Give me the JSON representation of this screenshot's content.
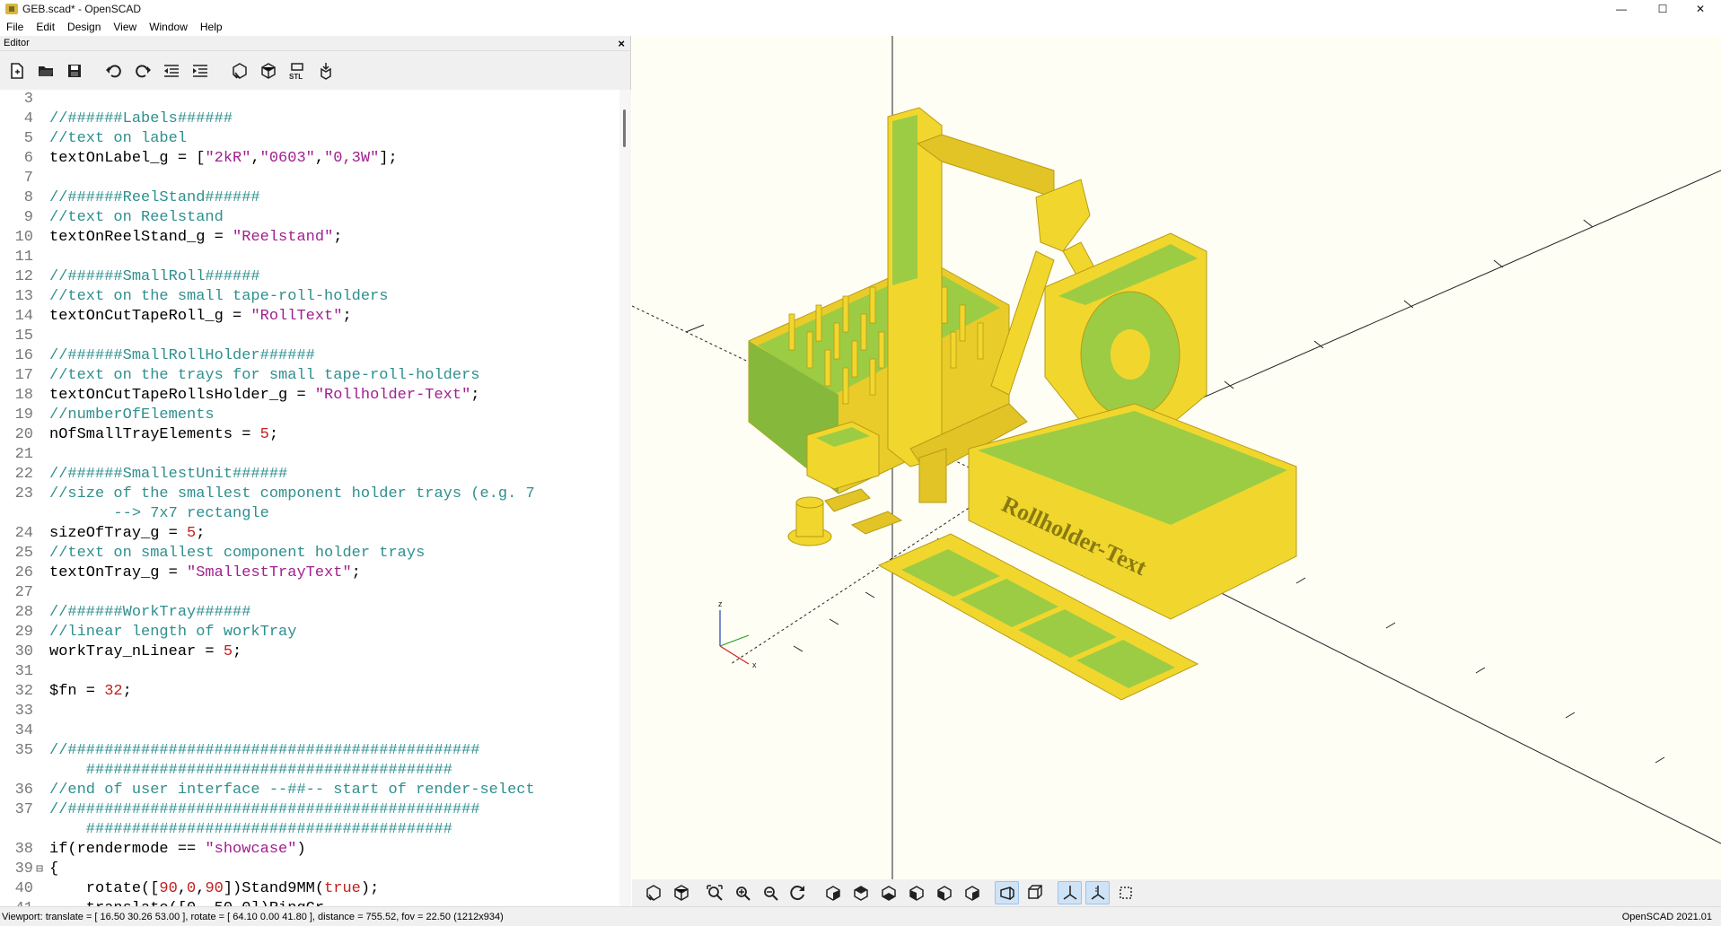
{
  "window": {
    "title": "GEB.scad* - OpenSCAD",
    "minimize_glyph": "—",
    "maximize_glyph": "☐",
    "close_glyph": "✕"
  },
  "menu": [
    "File",
    "Edit",
    "Design",
    "View",
    "Window",
    "Help"
  ],
  "editor": {
    "panel_title": "Editor",
    "close_glyph": "×",
    "toolbar_icons": [
      "new-file-icon",
      "open-file-icon",
      "save-icon",
      "undo-icon",
      "redo-icon",
      "unindent-icon",
      "indent-icon",
      "preview-icon",
      "render-icon",
      "export-stl-icon",
      "send-to-print-icon"
    ],
    "lines": [
      {
        "n": "3",
        "fold": "",
        "segs": []
      },
      {
        "n": "4",
        "fold": "",
        "segs": [
          {
            "t": "//######Labels######",
            "c": "cmt"
          }
        ]
      },
      {
        "n": "5",
        "fold": "",
        "segs": [
          {
            "t": "//text on label",
            "c": "cmt"
          }
        ]
      },
      {
        "n": "6",
        "fold": "",
        "segs": [
          {
            "t": "textOnLabel_g = [",
            "c": ""
          },
          {
            "t": "\"2kR\"",
            "c": "str"
          },
          {
            "t": ",",
            "c": ""
          },
          {
            "t": "\"0603\"",
            "c": "str"
          },
          {
            "t": ",",
            "c": ""
          },
          {
            "t": "\"0,3W\"",
            "c": "str"
          },
          {
            "t": "];",
            "c": ""
          }
        ]
      },
      {
        "n": "7",
        "fold": "",
        "segs": []
      },
      {
        "n": "8",
        "fold": "",
        "segs": [
          {
            "t": "//######ReelStand######",
            "c": "cmt"
          }
        ]
      },
      {
        "n": "9",
        "fold": "",
        "segs": [
          {
            "t": "//text on Reelstand",
            "c": "cmt"
          }
        ]
      },
      {
        "n": "10",
        "fold": "",
        "segs": [
          {
            "t": "textOnReelStand_g = ",
            "c": ""
          },
          {
            "t": "\"Reelstand\"",
            "c": "str"
          },
          {
            "t": ";",
            "c": ""
          }
        ]
      },
      {
        "n": "11",
        "fold": "",
        "segs": []
      },
      {
        "n": "12",
        "fold": "",
        "segs": [
          {
            "t": "//######SmallRoll######",
            "c": "cmt"
          }
        ]
      },
      {
        "n": "13",
        "fold": "",
        "segs": [
          {
            "t": "//text on the small tape-roll-holders",
            "c": "cmt"
          }
        ]
      },
      {
        "n": "14",
        "fold": "",
        "segs": [
          {
            "t": "textOnCutTapeRoll_g = ",
            "c": ""
          },
          {
            "t": "\"RollText\"",
            "c": "str"
          },
          {
            "t": ";",
            "c": ""
          }
        ]
      },
      {
        "n": "15",
        "fold": "",
        "segs": []
      },
      {
        "n": "16",
        "fold": "",
        "segs": [
          {
            "t": "//######SmallRollHolder######",
            "c": "cmt"
          }
        ]
      },
      {
        "n": "17",
        "fold": "",
        "segs": [
          {
            "t": "//text on the trays for small tape-roll-holders",
            "c": "cmt"
          }
        ]
      },
      {
        "n": "18",
        "fold": "",
        "segs": [
          {
            "t": "textOnCutTapeRollsHolder_g = ",
            "c": ""
          },
          {
            "t": "\"Rollholder-Text\"",
            "c": "str"
          },
          {
            "t": ";",
            "c": ""
          }
        ]
      },
      {
        "n": "19",
        "fold": "",
        "segs": [
          {
            "t": "//numberOfElements",
            "c": "cmt"
          }
        ]
      },
      {
        "n": "20",
        "fold": "",
        "segs": [
          {
            "t": "nOfSmallTrayElements = ",
            "c": ""
          },
          {
            "t": "5",
            "c": "num"
          },
          {
            "t": ";",
            "c": ""
          }
        ]
      },
      {
        "n": "21",
        "fold": "",
        "segs": []
      },
      {
        "n": "22",
        "fold": "",
        "segs": [
          {
            "t": "//######SmallestUnit######",
            "c": "cmt"
          }
        ]
      },
      {
        "n": "23",
        "fold": "",
        "wrap": true,
        "segs": [
          {
            "t": "//size of the smallest component holder trays (e.g. 7\n       --> 7x7 rectangle",
            "c": "cmt"
          }
        ]
      },
      {
        "n": "24",
        "fold": "",
        "segs": [
          {
            "t": "sizeOfTray_g = ",
            "c": ""
          },
          {
            "t": "5",
            "c": "num"
          },
          {
            "t": ";",
            "c": ""
          }
        ]
      },
      {
        "n": "25",
        "fold": "",
        "segs": [
          {
            "t": "//text on smallest component holder trays",
            "c": "cmt"
          }
        ]
      },
      {
        "n": "26",
        "fold": "",
        "segs": [
          {
            "t": "textOnTray_g = ",
            "c": ""
          },
          {
            "t": "\"SmallestTrayText\"",
            "c": "str"
          },
          {
            "t": ";",
            "c": ""
          }
        ]
      },
      {
        "n": "27",
        "fold": "",
        "segs": []
      },
      {
        "n": "28",
        "fold": "",
        "segs": [
          {
            "t": "//######WorkTray######",
            "c": "cmt"
          }
        ]
      },
      {
        "n": "29",
        "fold": "",
        "segs": [
          {
            "t": "//linear length of workTray",
            "c": "cmt"
          }
        ]
      },
      {
        "n": "30",
        "fold": "",
        "segs": [
          {
            "t": "workTray_nLinear = ",
            "c": ""
          },
          {
            "t": "5",
            "c": "num"
          },
          {
            "t": ";",
            "c": ""
          }
        ]
      },
      {
        "n": "31",
        "fold": "",
        "segs": []
      },
      {
        "n": "32",
        "fold": "",
        "segs": [
          {
            "t": "$fn = ",
            "c": ""
          },
          {
            "t": "32",
            "c": "num"
          },
          {
            "t": ";",
            "c": ""
          }
        ]
      },
      {
        "n": "33",
        "fold": "",
        "segs": []
      },
      {
        "n": "34",
        "fold": "",
        "segs": []
      },
      {
        "n": "35",
        "fold": "",
        "wrap": true,
        "segs": [
          {
            "t": "//#############################################\n    ########################################",
            "c": "cmt"
          }
        ]
      },
      {
        "n": "36",
        "fold": "",
        "segs": [
          {
            "t": "//end of user interface --##-- start of render-select",
            "c": "cmt"
          }
        ]
      },
      {
        "n": "37",
        "fold": "",
        "wrap": true,
        "segs": [
          {
            "t": "//#############################################\n    ########################################",
            "c": "cmt"
          }
        ]
      },
      {
        "n": "38",
        "fold": "",
        "segs": [
          {
            "t": "if(rendermode == ",
            "c": ""
          },
          {
            "t": "\"showcase\"",
            "c": "str"
          },
          {
            "t": ")",
            "c": ""
          }
        ]
      },
      {
        "n": "39",
        "fold": "⊟",
        "segs": [
          {
            "t": "{",
            "c": ""
          }
        ]
      },
      {
        "n": "40",
        "fold": "",
        "segs": [
          {
            "t": "    rotate([",
            "c": ""
          },
          {
            "t": "90",
            "c": "num"
          },
          {
            "t": ",",
            "c": ""
          },
          {
            "t": "0",
            "c": "num"
          },
          {
            "t": ",",
            "c": ""
          },
          {
            "t": "90",
            "c": "num"
          },
          {
            "t": "])Stand9MM(",
            "c": ""
          },
          {
            "t": "true",
            "c": "num"
          },
          {
            "t": ");",
            "c": ""
          }
        ]
      },
      {
        "n": "41",
        "fold": "",
        "segs": [
          {
            "t": "    translate([0,-50,0])RingCr...",
            "c": ""
          }
        ]
      }
    ]
  },
  "viewport": {
    "background": "#fefef4",
    "model_yellow": "#f1d72d",
    "model_green": "#9ccc44",
    "axis_labels": {
      "z": "z",
      "x": "x"
    },
    "engraved_text": "Rollholder-Text"
  },
  "view_toolbar_icons": [
    "preview-icon",
    "render-icon",
    "view-all-icon",
    "zoom-in-icon",
    "zoom-out-icon",
    "reset-view-icon",
    "view-right-icon",
    "view-top-icon",
    "view-bottom-icon",
    "view-left-icon",
    "view-front-icon",
    "view-back-icon",
    "perspective-icon",
    "orthogonal-icon",
    "show-axes-icon",
    "show-scale-icon",
    "show-edges-icon"
  ],
  "status": {
    "left": "Viewport: translate = [ 16.50 30.26 53.00 ], rotate = [ 64.10 0.00 41.80 ], distance = 755.52, fov = 22.50 (1212x934)",
    "right": "OpenSCAD 2021.01"
  }
}
